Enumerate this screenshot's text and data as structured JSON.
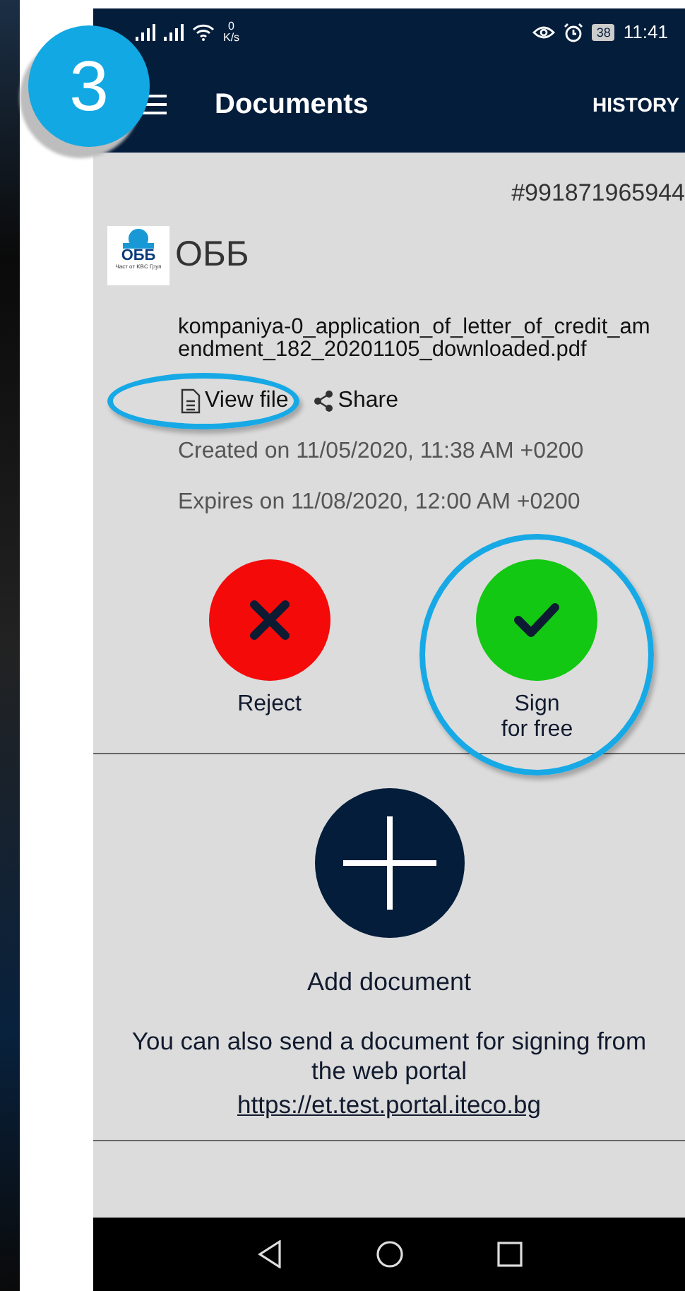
{
  "step_badge": "3",
  "status_bar": {
    "speed_value": "0",
    "speed_unit": "K/s",
    "battery": "38",
    "time": "11:41"
  },
  "app_bar": {
    "title": "Documents",
    "action": "HISTORY"
  },
  "document": {
    "number": "#991871965944",
    "logo_text": "ОББ",
    "logo_tagline": "Част от KBC Груп",
    "sender": "ОББ",
    "file_name": "kompaniya-0_application_of_letter_of_credit_amendment_182_20201105_downloaded.pdf",
    "actions": [
      {
        "kind": "view",
        "label": "View file",
        "highlighted": true
      },
      {
        "kind": "share",
        "label": "Share",
        "highlighted": false
      }
    ],
    "created": "Created on 11/05/2020, 11:38 AM +0200",
    "expires": "Expires on 11/08/2020, 12:00 AM +0200",
    "decisions": [
      {
        "kind": "reject",
        "label": "Reject",
        "highlighted": false
      },
      {
        "kind": "sign",
        "label": "Sign\nfor free",
        "highlighted": true
      }
    ]
  },
  "add_document": {
    "label": "Add document",
    "note": "You can also send a document for signing from the web portal",
    "link": "https://et.test.portal.iteco.bg"
  }
}
